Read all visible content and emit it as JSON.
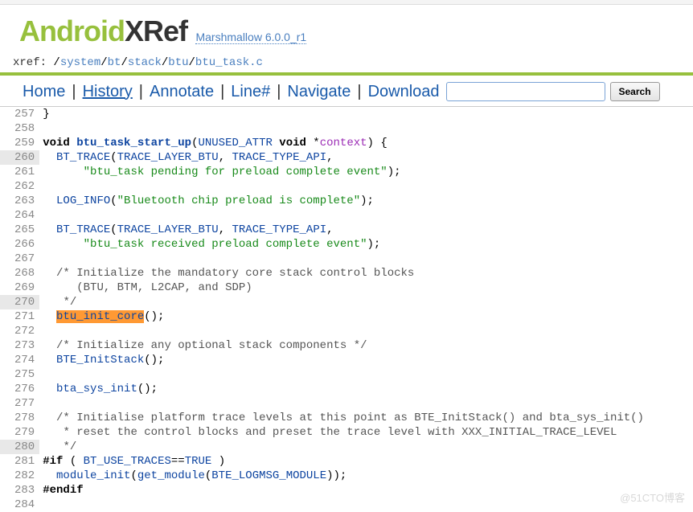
{
  "logo": {
    "part1": "Android",
    "part2": "XRef"
  },
  "version": "Marshmallow 6.0.0_r1",
  "breadcrumb": {
    "label": "xref: ",
    "parts": [
      "/",
      "system",
      "/",
      "bt",
      "/",
      "stack",
      "/",
      "btu",
      "/",
      "btu_task.c"
    ]
  },
  "toolbar": {
    "home": "Home",
    "history": "History",
    "annotate": "Annotate",
    "linenum": "Line#",
    "navigate": "Navigate",
    "download": "Download",
    "search_btn": "Search",
    "search_val": ""
  },
  "lines": {
    "start": 257,
    "shaded": [
      260,
      270,
      280
    ],
    "rows": [
      {
        "n": 257,
        "frag": [
          {
            "t": "}"
          }
        ]
      },
      {
        "n": 258,
        "frag": []
      },
      {
        "n": 259,
        "frag": [
          {
            "c": "kw",
            "t": "void "
          },
          {
            "c": "fn",
            "t": "btu_task_start_up"
          },
          {
            "t": "("
          },
          {
            "c": "id-blue",
            "t": "UNUSED_ATTR"
          },
          {
            "t": " "
          },
          {
            "c": "kw",
            "t": "void"
          },
          {
            "t": " *"
          },
          {
            "c": "arg",
            "t": "context"
          },
          {
            "t": ") {"
          }
        ]
      },
      {
        "n": 260,
        "frag": [
          {
            "t": "  "
          },
          {
            "c": "id-blue",
            "t": "BT_TRACE"
          },
          {
            "t": "("
          },
          {
            "c": "id-blue",
            "t": "TRACE_LAYER_BTU"
          },
          {
            "t": ", "
          },
          {
            "c": "id-blue",
            "t": "TRACE_TYPE_API"
          },
          {
            "t": ","
          }
        ]
      },
      {
        "n": 261,
        "frag": [
          {
            "t": "      "
          },
          {
            "c": "str",
            "t": "\"btu_task pending for preload complete event\""
          },
          {
            "t": ");"
          }
        ]
      },
      {
        "n": 262,
        "frag": []
      },
      {
        "n": 263,
        "frag": [
          {
            "t": "  "
          },
          {
            "c": "id-blue",
            "t": "LOG_INFO"
          },
          {
            "t": "("
          },
          {
            "c": "str",
            "t": "\"Bluetooth chip preload is complete\""
          },
          {
            "t": ");"
          }
        ]
      },
      {
        "n": 264,
        "frag": []
      },
      {
        "n": 265,
        "frag": [
          {
            "t": "  "
          },
          {
            "c": "id-blue",
            "t": "BT_TRACE"
          },
          {
            "t": "("
          },
          {
            "c": "id-blue",
            "t": "TRACE_LAYER_BTU"
          },
          {
            "t": ", "
          },
          {
            "c": "id-blue",
            "t": "TRACE_TYPE_API"
          },
          {
            "t": ","
          }
        ]
      },
      {
        "n": 266,
        "frag": [
          {
            "t": "      "
          },
          {
            "c": "str",
            "t": "\"btu_task received preload complete event\""
          },
          {
            "t": ");"
          }
        ]
      },
      {
        "n": 267,
        "frag": []
      },
      {
        "n": 268,
        "frag": [
          {
            "t": "  "
          },
          {
            "c": "cmt",
            "t": "/* Initialize the mandatory core stack control blocks"
          }
        ]
      },
      {
        "n": 269,
        "frag": [
          {
            "t": "     "
          },
          {
            "c": "cmt",
            "t": "(BTU, BTM, L2CAP, and SDP)"
          }
        ]
      },
      {
        "n": 270,
        "frag": [
          {
            "t": "   "
          },
          {
            "c": "cmt",
            "t": "*/"
          }
        ]
      },
      {
        "n": 271,
        "frag": [
          {
            "t": "  "
          },
          {
            "c": "hl",
            "t": "btu_init_core"
          },
          {
            "t": "();"
          }
        ]
      },
      {
        "n": 272,
        "frag": []
      },
      {
        "n": 273,
        "frag": [
          {
            "t": "  "
          },
          {
            "c": "cmt",
            "t": "/* Initialize any optional stack components */"
          }
        ]
      },
      {
        "n": 274,
        "frag": [
          {
            "t": "  "
          },
          {
            "c": "id-blue",
            "t": "BTE_InitStack"
          },
          {
            "t": "();"
          }
        ]
      },
      {
        "n": 275,
        "frag": []
      },
      {
        "n": 276,
        "frag": [
          {
            "t": "  "
          },
          {
            "c": "id-blue",
            "t": "bta_sys_init"
          },
          {
            "t": "();"
          }
        ]
      },
      {
        "n": 277,
        "frag": []
      },
      {
        "n": 278,
        "frag": [
          {
            "t": "  "
          },
          {
            "c": "cmt",
            "t": "/* Initialise platform trace levels at this point as BTE_InitStack() and bta_sys_init()"
          }
        ]
      },
      {
        "n": 279,
        "frag": [
          {
            "t": "   "
          },
          {
            "c": "cmt",
            "t": "* reset the control blocks and preset the trace level with XXX_INITIAL_TRACE_LEVEL"
          }
        ]
      },
      {
        "n": 280,
        "frag": [
          {
            "t": "   "
          },
          {
            "c": "cmt",
            "t": "*/"
          }
        ]
      },
      {
        "n": 281,
        "frag": [
          {
            "c": "kw",
            "t": "#if"
          },
          {
            "t": " ( "
          },
          {
            "c": "id-blue",
            "t": "BT_USE_TRACES"
          },
          {
            "t": "=="
          },
          {
            "c": "id-blue",
            "t": "TRUE"
          },
          {
            "t": " )"
          }
        ]
      },
      {
        "n": 282,
        "frag": [
          {
            "t": "  "
          },
          {
            "c": "id-blue",
            "t": "module_init"
          },
          {
            "t": "("
          },
          {
            "c": "id-blue",
            "t": "get_module"
          },
          {
            "t": "("
          },
          {
            "c": "id-blue",
            "t": "BTE_LOGMSG_MODULE"
          },
          {
            "t": "));"
          }
        ]
      },
      {
        "n": 283,
        "frag": [
          {
            "c": "kw",
            "t": "#endif"
          }
        ]
      },
      {
        "n": 284,
        "frag": []
      }
    ]
  },
  "watermark": "@51CTO博客"
}
